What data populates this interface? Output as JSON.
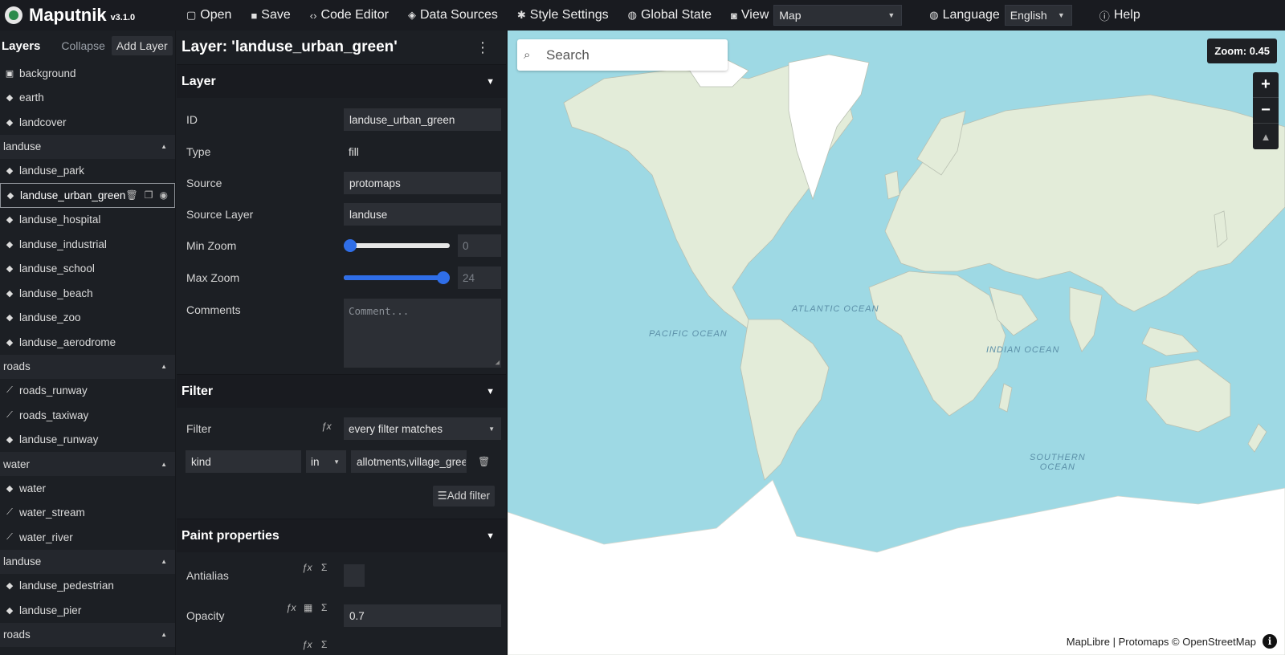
{
  "app": {
    "name": "Maputnik",
    "version": "v3.1.0"
  },
  "toolbar": {
    "open": "Open",
    "save": "Save",
    "code_editor": "Code Editor",
    "data_sources": "Data Sources",
    "style_settings": "Style Settings",
    "global_state": "Global State",
    "view": "View",
    "view_value": "Map",
    "language": "Language",
    "language_value": "English",
    "help": "Help"
  },
  "layers_panel": {
    "title": "Layers",
    "collapse": "Collapse",
    "add_layer": "Add Layer",
    "items": [
      {
        "kind": "layer",
        "label": "background",
        "icon": "background-icon"
      },
      {
        "kind": "layer",
        "label": "earth",
        "icon": "fill-icon"
      },
      {
        "kind": "layer",
        "label": "landcover",
        "icon": "fill-icon"
      },
      {
        "kind": "group",
        "label": "landuse"
      },
      {
        "kind": "layer",
        "label": "landuse_park",
        "icon": "fill-icon"
      },
      {
        "kind": "layer",
        "label": "landuse_urban_green",
        "icon": "fill-icon",
        "selected": true
      },
      {
        "kind": "layer",
        "label": "landuse_hospital",
        "icon": "fill-icon"
      },
      {
        "kind": "layer",
        "label": "landuse_industrial",
        "icon": "fill-icon"
      },
      {
        "kind": "layer",
        "label": "landuse_school",
        "icon": "fill-icon"
      },
      {
        "kind": "layer",
        "label": "landuse_beach",
        "icon": "fill-icon"
      },
      {
        "kind": "layer",
        "label": "landuse_zoo",
        "icon": "fill-icon"
      },
      {
        "kind": "layer",
        "label": "landuse_aerodrome",
        "icon": "fill-icon"
      },
      {
        "kind": "group",
        "label": "roads"
      },
      {
        "kind": "layer",
        "label": "roads_runway",
        "icon": "line-icon"
      },
      {
        "kind": "layer",
        "label": "roads_taxiway",
        "icon": "line-icon"
      },
      {
        "kind": "layer",
        "label": "landuse_runway",
        "icon": "fill-icon"
      },
      {
        "kind": "group",
        "label": "water"
      },
      {
        "kind": "layer",
        "label": "water",
        "icon": "fill-icon"
      },
      {
        "kind": "layer",
        "label": "water_stream",
        "icon": "line-icon"
      },
      {
        "kind": "layer",
        "label": "water_river",
        "icon": "line-icon"
      },
      {
        "kind": "group",
        "label": "landuse"
      },
      {
        "kind": "layer",
        "label": "landuse_pedestrian",
        "icon": "fill-icon"
      },
      {
        "kind": "layer",
        "label": "landuse_pier",
        "icon": "fill-icon"
      },
      {
        "kind": "group",
        "label": "roads"
      }
    ]
  },
  "editor": {
    "title": "Layer: 'landuse_urban_green'",
    "layer_section": "Layer",
    "id_label": "ID",
    "id_value": "landuse_urban_green",
    "type_label": "Type",
    "type_value": "fill",
    "source_label": "Source",
    "source_value": "protomaps",
    "source_layer_label": "Source Layer",
    "source_layer_value": "landuse",
    "min_zoom_label": "Min Zoom",
    "min_zoom_value": "0",
    "max_zoom_label": "Max Zoom",
    "max_zoom_value": "24",
    "comments_label": "Comments",
    "comments_placeholder": "Comment...",
    "filter_section": "Filter",
    "filter_label": "Filter",
    "filter_mode": "every filter matches",
    "filter_key": "kind",
    "filter_op": "in",
    "filter_values": "allotments,village_gree",
    "add_filter": "Add filter",
    "paint_section": "Paint properties",
    "antialias_label": "Antialias",
    "opacity_label": "Opacity",
    "opacity_value": "0.7"
  },
  "map": {
    "search_placeholder": "Search",
    "zoom_badge": "Zoom: 0.45",
    "oceans": {
      "pacific": "PACIFIC OCEAN",
      "atlantic": "ATLANTIC OCEAN",
      "indian": "INDIAN OCEAN",
      "southern_1": "SOUTHERN",
      "southern_2": "OCEAN"
    },
    "attribution": "MapLibre | Protomaps © OpenStreetMap",
    "colors": {
      "ocean": "#9ed9e4",
      "land": "#e3ecd9",
      "ice": "#ffffff"
    }
  }
}
